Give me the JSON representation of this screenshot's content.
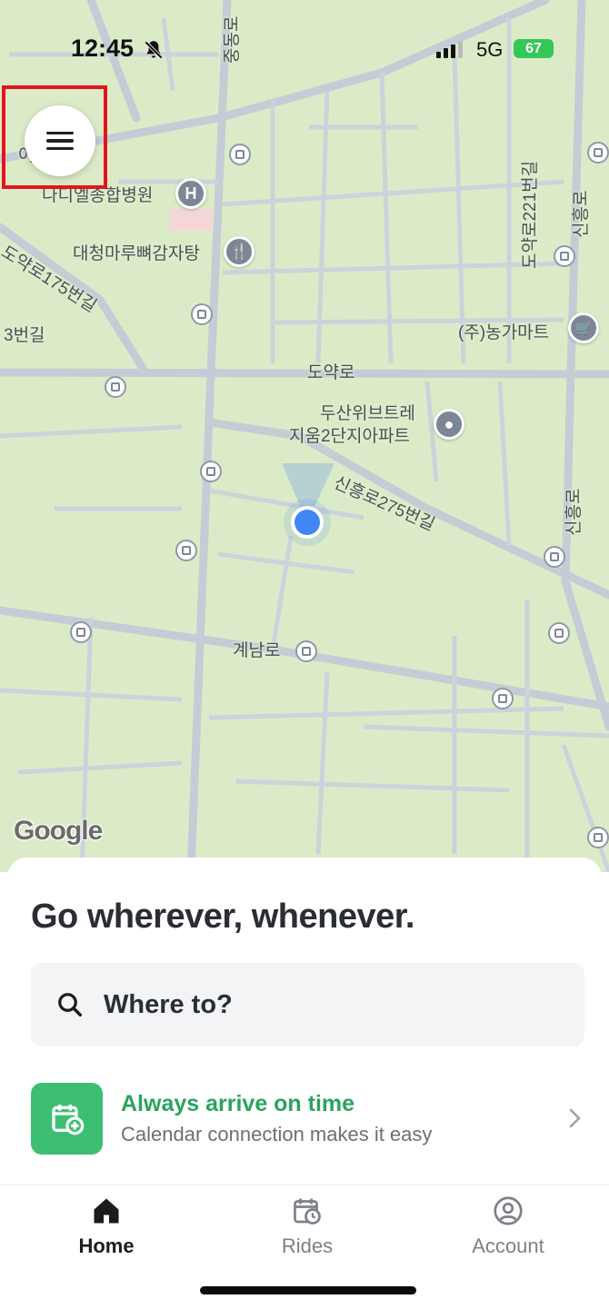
{
  "status_bar": {
    "time": "12:45",
    "network": "5G",
    "battery": "67"
  },
  "map": {
    "labels": {
      "hospital": "나디엘종합병원",
      "restaurant": "대청마루뼈감자탕",
      "road_doyakro175": "도약로175번길",
      "road_3": "3번길",
      "road_doyakro": "도약로",
      "apartment_line1": "두산위브트레",
      "apartment_line2": "지움2단지아파트",
      "road_sinheungro275": "신흥로275번길",
      "mart": "(주)농가마트",
      "road_gyenamro": "계남로",
      "road_doyakro221": "도약로221번길",
      "road_sinheungro": "신흥로",
      "road_sinheungro_lower": "신흥로",
      "road_joongangro": "중동로",
      "partial_left": "어"
    },
    "google_logo": "Google"
  },
  "sheet": {
    "headline": "Go wherever, whenever.",
    "search_label": "Where to?",
    "promo_title": "Always arrive on time",
    "promo_subtitle": "Calendar connection makes it easy"
  },
  "nav": {
    "items": [
      {
        "label": "Home",
        "icon": "home-icon",
        "active": true
      },
      {
        "label": "Rides",
        "icon": "calendar-clock-icon",
        "active": false
      },
      {
        "label": "Account",
        "icon": "account-icon",
        "active": false
      }
    ]
  },
  "colors": {
    "map_background": "#dcebc7",
    "road": "#c3ccd4",
    "accent_green": "#3dbf73",
    "location_dot": "#4285f4",
    "highlight": "#e1161c"
  }
}
